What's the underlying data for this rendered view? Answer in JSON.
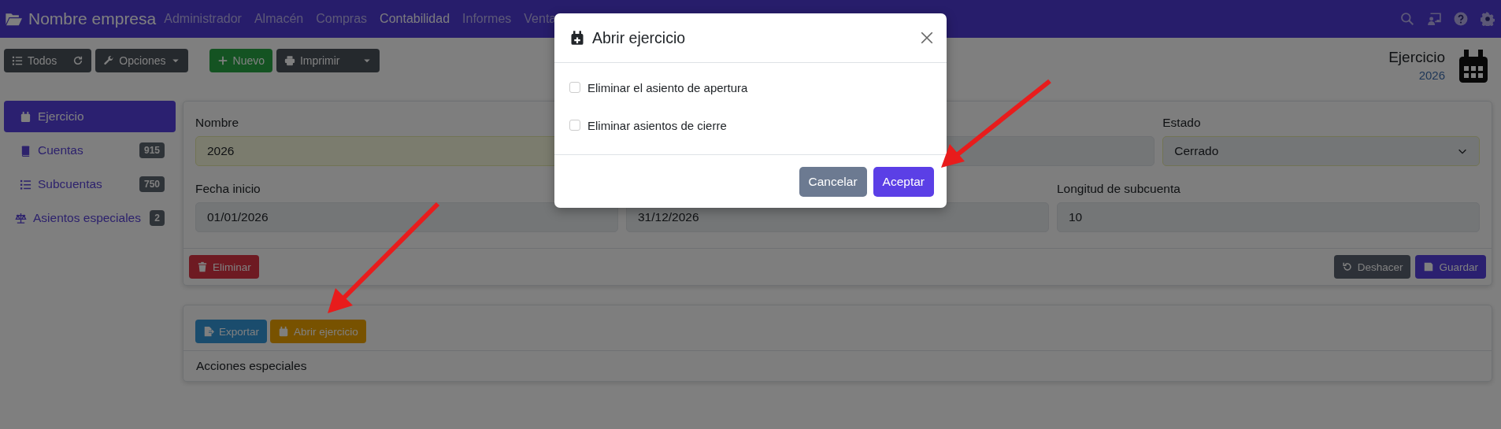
{
  "navbar": {
    "brand": "Nombre empresa",
    "menu": [
      {
        "label": "Administrador",
        "selected": false
      },
      {
        "label": "Almacén",
        "selected": false
      },
      {
        "label": "Compras",
        "selected": false
      },
      {
        "label": "Contabilidad",
        "selected": true
      },
      {
        "label": "Informes",
        "selected": false
      },
      {
        "label": "Venta",
        "selected": false
      }
    ],
    "icons": [
      {
        "kind": "search"
      },
      {
        "kind": "user-screen"
      },
      {
        "kind": "help"
      },
      {
        "kind": "settings"
      }
    ]
  },
  "toolbar": {
    "buttons": [
      {
        "label": "Todos",
        "kind": "list"
      },
      {
        "label": "Opciones",
        "kind": "options"
      },
      {
        "label": "Nuevo",
        "kind": "new"
      },
      {
        "label": "Imprimir",
        "kind": "print"
      }
    ]
  },
  "header": {
    "title": "Ejercicio",
    "subtitle": "2026"
  },
  "sidebar": {
    "items": [
      {
        "label": "Ejercicio",
        "kind": "calendar",
        "selected": true
      },
      {
        "label": "Cuentas",
        "kind": "book",
        "badge": "915",
        "selected": false
      },
      {
        "label": "Subcuentas",
        "kind": "list",
        "badge": "750",
        "selected": false
      },
      {
        "label": "Asientos especiales",
        "kind": "scale",
        "badge": "2",
        "selected": false
      }
    ]
  },
  "form": {
    "rows": [
      {
        "fields": [
          {
            "label": "Nombre",
            "value": "2026",
            "kind": "input",
            "highlighted": true
          },
          {
            "kind": "input",
            "highlighted": false
          },
          {
            "label": "Estado",
            "value": "Cerrado",
            "kind": "select",
            "highlighted": true
          }
        ]
      },
      {
        "fields": [
          {
            "label": "Fecha inicio",
            "value": "01/01/2026",
            "kind": "input",
            "highlighted": false
          },
          {
            "value": "31/12/2026",
            "kind": "input",
            "highlighted": false
          },
          {
            "label": "Longitud de subcuenta",
            "value": "10",
            "kind": "input",
            "highlighted": false
          }
        ]
      }
    ],
    "buttons": [
      {
        "label": "Eliminar",
        "kind": "delete"
      },
      {
        "label": "Deshacer",
        "kind": "undo"
      },
      {
        "label": "Guardar",
        "kind": "save"
      }
    ]
  },
  "actions": {
    "buttons": [
      {
        "label": "Exportar",
        "kind": "export"
      },
      {
        "label": "Abrir ejercicio",
        "kind": "open"
      }
    ],
    "footer": "Acciones especiales"
  },
  "dialog": {
    "title": "Abrir ejercicio",
    "options": [
      {
        "label": "Eliminar el asiento de apertura",
        "checked": false
      },
      {
        "label": "Eliminar asientos de cierre",
        "checked": false
      }
    ],
    "buttons": [
      {
        "label": "Cancelar",
        "kind": "cancel"
      },
      {
        "label": "Aceptar",
        "kind": "accept"
      }
    ]
  }
}
